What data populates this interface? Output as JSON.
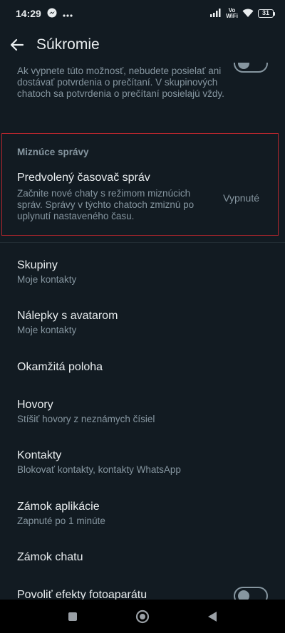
{
  "status_bar": {
    "time": "14:29",
    "volte_line1": "Vo",
    "volte_line2": "WiFi",
    "battery": "31",
    "icons": [
      "messenger-icon",
      "more-dots-icon",
      "signal-icon",
      "wifi-icon",
      "battery-icon"
    ]
  },
  "app_bar": {
    "title": "Súkromie",
    "back_icon": "arrow-left-icon"
  },
  "read_receipts_fragment": {
    "description": "Ak vypnete túto možnosť, nebudete posielať ani dostávať potvrdenia o prečítaní. V skupinových chatoch sa potvrdenia o prečítaní posielajú vždy.",
    "toggle_on": false
  },
  "disappearing_messages": {
    "header": "Miznúce správy",
    "timer_title": "Predvolený časovač správ",
    "timer_description": "Začnite nové chaty s režimom miznúcich správ. Správy v týchto chatoch zmiznú po uplynutí nastaveného času.",
    "timer_value": "Vypnuté",
    "highlight_color": "#b3262d"
  },
  "settings": [
    {
      "title": "Skupiny",
      "subtitle": "Moje kontakty"
    },
    {
      "title": "Nálepky s avatarom",
      "subtitle": "Moje kontakty"
    },
    {
      "title": "Okamžitá poloha",
      "subtitle": ""
    },
    {
      "title": "Hovory",
      "subtitle": "Stíšiť hovory z neznámych čísiel"
    },
    {
      "title": "Kontakty",
      "subtitle": "Blokovať kontakty, kontakty WhatsApp"
    },
    {
      "title": "Zámok aplikácie",
      "subtitle": "Zapnuté po 1 minúte"
    },
    {
      "title": "Zámok chatu",
      "subtitle": ""
    },
    {
      "title": "Povoliť efekty fotoaparátu",
      "subtitle": "",
      "toggle_on": false
    }
  ],
  "nav_bar": {
    "icons": [
      "recents-square-icon",
      "home-circle-icon",
      "back-triangle-icon"
    ]
  },
  "colors": {
    "background": "#121b22",
    "primary_text": "#e9edef",
    "secondary_text": "#8696a0",
    "divider": "#222d34"
  }
}
